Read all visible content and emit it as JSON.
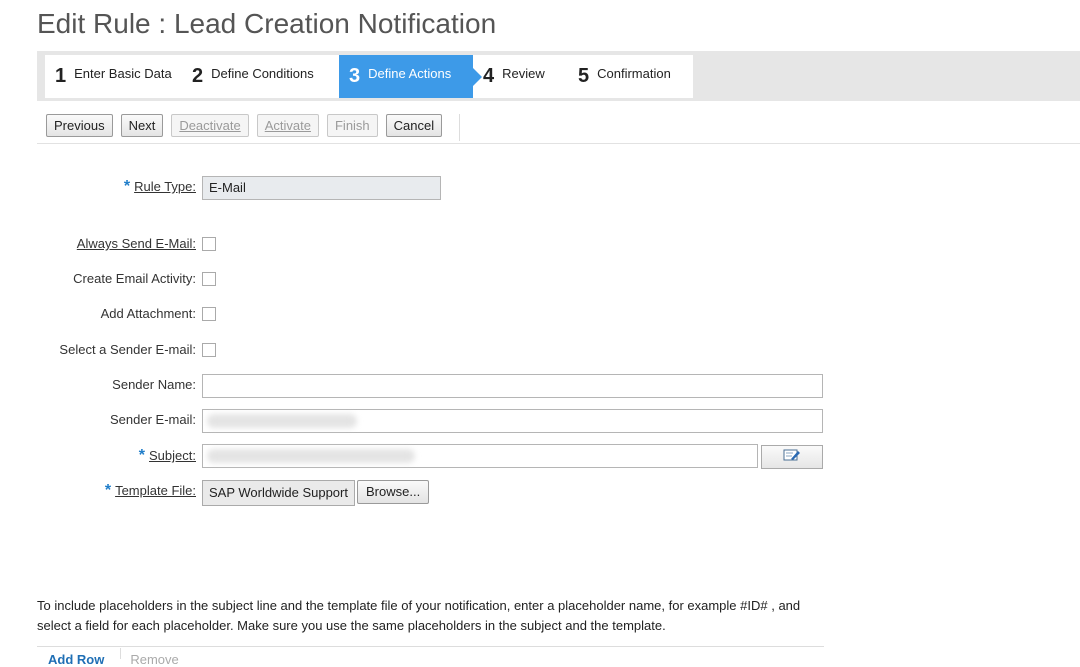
{
  "page": {
    "title": "Edit Rule : Lead Creation Notification"
  },
  "wizard": {
    "steps": [
      {
        "num": "1",
        "label": "Enter Basic Data"
      },
      {
        "num": "2",
        "label": "Define Conditions"
      },
      {
        "num": "3",
        "label": "Define Actions"
      },
      {
        "num": "4",
        "label": "Review"
      },
      {
        "num": "5",
        "label": "Confirmation"
      }
    ],
    "active_step": 3
  },
  "toolbar": {
    "previous": "Previous",
    "next": "Next",
    "deactivate": "Deactivate",
    "activate": "Activate",
    "finish": "Finish",
    "cancel": "Cancel"
  },
  "form": {
    "rule_type_label": "Rule Type:",
    "rule_type_value": "E-Mail",
    "always_send_label": "Always Send E-Mail:",
    "create_activity_label": "Create Email Activity:",
    "add_attachment_label": "Add Attachment:",
    "select_sender_label": "Select a Sender E-mail:",
    "sender_name_label": "Sender Name:",
    "sender_name_value": "",
    "sender_email_label": "Sender E-mail:",
    "subject_label": "Subject:",
    "template_label": "Template File:",
    "template_value": "SAP Worldwide Support",
    "browse_label": "Browse..."
  },
  "info": {
    "text": "To include placeholders in the subject line and the template file of your notification, enter a placeholder name, for example #ID# , and select a field for each placeholder. Make sure you use the same placeholders in the subject and the template."
  },
  "bottom": {
    "add_row": "Add Row",
    "remove": "Remove"
  },
  "colors": {
    "accent": "#3d9ae8",
    "required": "#1f7dc9"
  }
}
